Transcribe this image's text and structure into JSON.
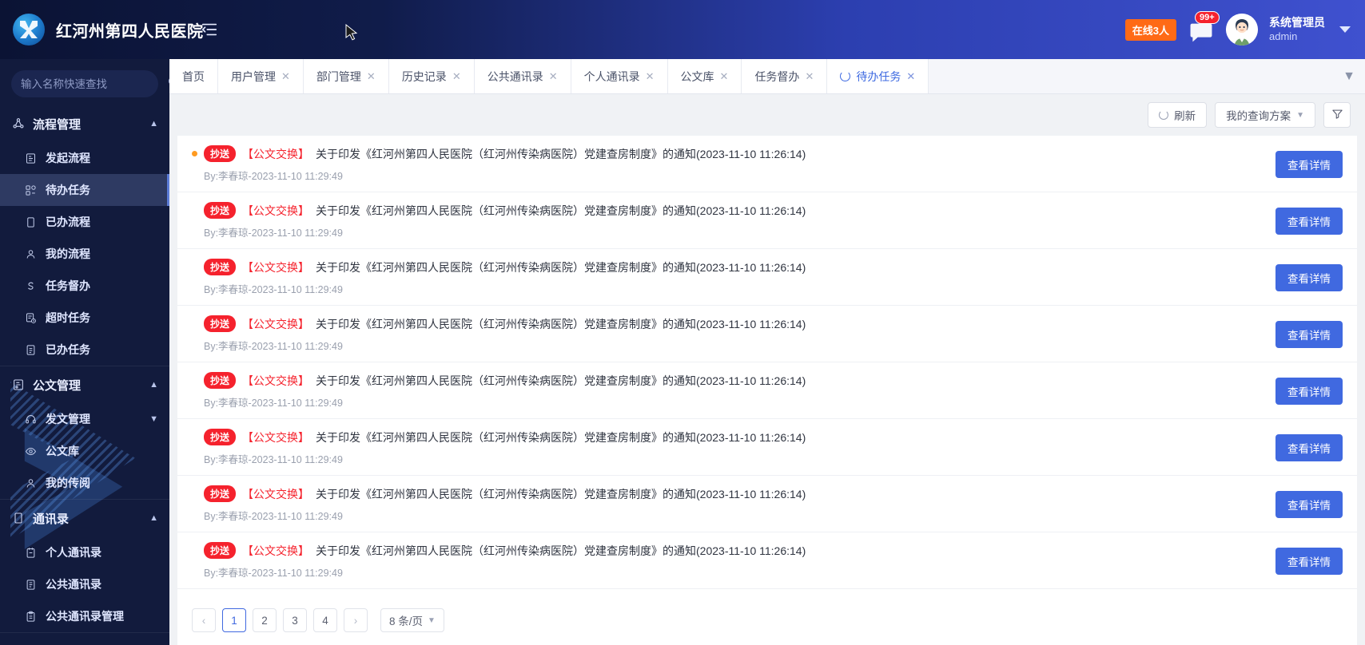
{
  "header": {
    "brand_name": "红河州第四人民医院",
    "collapse_icon": "menu-fold-icon",
    "logo_icon": "hospital-logo-icon",
    "online_badge": "在线3人",
    "message_icon": "message-bubble-icon",
    "message_count": "99+",
    "avatar_icon": "user-avatar-icon",
    "user_name": "系统管理员",
    "user_login": "admin",
    "caret_icon": "chevron-down-icon",
    "gradient_start": "#0b1334",
    "gradient_end": "#3f51cf"
  },
  "sidebar": {
    "search_placeholder": "输入名称快速查找",
    "search_value": "",
    "search_icon": "search-icon",
    "groups": [
      {
        "label": "流程管理",
        "icon": "flow-node-icon",
        "arrow": "chevron-up-icon",
        "items": [
          {
            "label": "发起流程",
            "icon": "start-flow-icon",
            "active": false
          },
          {
            "label": "待办任务",
            "icon": "todo-task-icon",
            "active": true
          },
          {
            "label": "已办流程",
            "icon": "done-flow-icon",
            "active": false
          },
          {
            "label": "我的流程",
            "icon": "my-flow-user-icon",
            "active": false
          },
          {
            "label": "任务督办",
            "icon": "supervise-icon",
            "active": false
          },
          {
            "label": "超时任务",
            "icon": "timeout-task-icon",
            "active": false
          },
          {
            "label": "已办任务",
            "icon": "done-task-icon",
            "active": false
          }
        ]
      },
      {
        "label": "公文管理",
        "icon": "document-manage-icon",
        "arrow": "chevron-up-icon",
        "items": [
          {
            "label": "发文管理",
            "icon": "send-doc-icon",
            "active": false,
            "sub_arrow": "chevron-down-icon"
          },
          {
            "label": "公文库",
            "icon": "doc-library-icon",
            "active": false
          },
          {
            "label": "我的传阅",
            "icon": "circulate-user-icon",
            "active": false
          }
        ]
      },
      {
        "label": "通讯录",
        "icon": "contacts-icon",
        "arrow": "chevron-up-icon",
        "items": [
          {
            "label": "个人通讯录",
            "icon": "personal-contacts-icon",
            "active": false
          },
          {
            "label": "公共通讯录",
            "icon": "public-contacts-icon",
            "active": false
          },
          {
            "label": "公共通讯录管理",
            "icon": "public-contacts-admin-icon",
            "active": false
          }
        ]
      }
    ]
  },
  "tabs": {
    "items": [
      {
        "label": "首页",
        "closable": false,
        "active": false
      },
      {
        "label": "用户管理",
        "closable": true,
        "active": false
      },
      {
        "label": "部门管理",
        "closable": true,
        "active": false
      },
      {
        "label": "历史记录",
        "closable": true,
        "active": false
      },
      {
        "label": "公共通讯录",
        "closable": true,
        "active": false
      },
      {
        "label": "个人通讯录",
        "closable": true,
        "active": false
      },
      {
        "label": "公文库",
        "closable": true,
        "active": false
      },
      {
        "label": "任务督办",
        "closable": true,
        "active": false
      },
      {
        "label": "待办任务",
        "closable": true,
        "active": true,
        "loading_icon": "loading-spinner-icon"
      }
    ],
    "close_icon": "close-x-icon",
    "more_icon": "chevron-down-icon"
  },
  "toolbar": {
    "refresh_label": "刷新",
    "refresh_icon": "refresh-spinner-icon",
    "query_plan_label": "我的查询方案",
    "query_plan_caret": "chevron-down-icon",
    "filter_icon": "filter-funnel-icon"
  },
  "list": {
    "detail_button_label": "查看详情",
    "tag_label": "抄送",
    "category_label": "【公文交换】",
    "rows": [
      {
        "unread": true,
        "title": "关于印发《红河州第四人民医院（红河州传染病医院）党建查房制度》的通知(2023-11-10 11:26:14)",
        "meta": "By:李春琼-2023-11-10 11:29:49"
      },
      {
        "unread": false,
        "title": "关于印发《红河州第四人民医院（红河州传染病医院）党建查房制度》的通知(2023-11-10 11:26:14)",
        "meta": "By:李春琼-2023-11-10 11:29:49"
      },
      {
        "unread": false,
        "title": "关于印发《红河州第四人民医院（红河州传染病医院）党建查房制度》的通知(2023-11-10 11:26:14)",
        "meta": "By:李春琼-2023-11-10 11:29:49"
      },
      {
        "unread": false,
        "title": "关于印发《红河州第四人民医院（红河州传染病医院）党建查房制度》的通知(2023-11-10 11:26:14)",
        "meta": "By:李春琼-2023-11-10 11:29:49"
      },
      {
        "unread": false,
        "title": "关于印发《红河州第四人民医院（红河州传染病医院）党建查房制度》的通知(2023-11-10 11:26:14)",
        "meta": "By:李春琼-2023-11-10 11:29:49"
      },
      {
        "unread": false,
        "title": "关于印发《红河州第四人民医院（红河州传染病医院）党建查房制度》的通知(2023-11-10 11:26:14)",
        "meta": "By:李春琼-2023-11-10 11:29:49"
      },
      {
        "unread": false,
        "title": "关于印发《红河州第四人民医院（红河州传染病医院）党建查房制度》的通知(2023-11-10 11:26:14)",
        "meta": "By:李春琼-2023-11-10 11:29:49"
      },
      {
        "unread": false,
        "title": "关于印发《红河州第四人民医院（红河州传染病医院）党建查房制度》的通知(2023-11-10 11:26:14)",
        "meta": "By:李春琼-2023-11-10 11:29:49"
      }
    ]
  },
  "pagination": {
    "prev_icon": "chevron-left-icon",
    "next_icon": "chevron-right-icon",
    "pages": [
      "1",
      "2",
      "3",
      "4"
    ],
    "active_page": "1",
    "page_size_label": "8 条/页",
    "page_size_caret": "chevron-down-icon"
  }
}
